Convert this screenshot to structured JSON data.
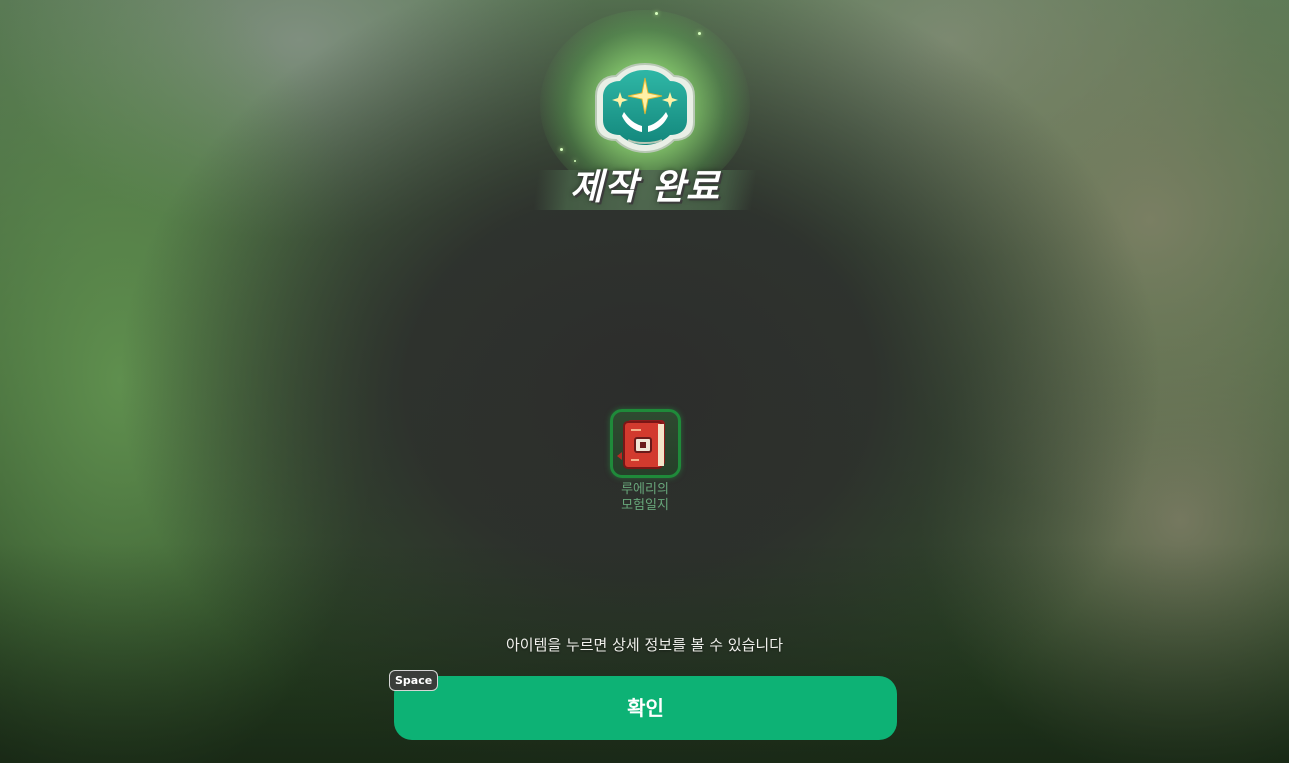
{
  "title": "제작 완료",
  "emblem_icon": "crafting-hands-star-emblem",
  "item": {
    "name_line1": "루에리의",
    "name_line2": "모험일지",
    "icon": "red-book-icon",
    "frame_color": "#1f8a3a"
  },
  "hint_text": "아이템을 누르면 상세 정보를 볼 수 있습니다",
  "confirm_button": {
    "label": "확인",
    "key_badge": "Space",
    "color": "#0db275"
  }
}
